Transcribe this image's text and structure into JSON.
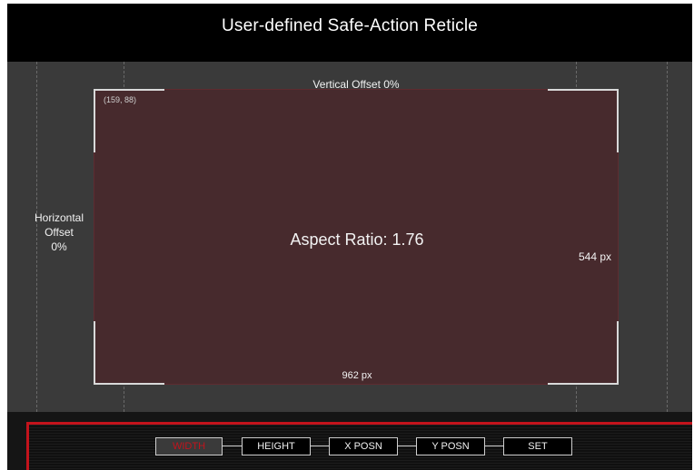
{
  "header": {
    "title": "User-defined Safe-Action Reticle"
  },
  "reticle": {
    "vertical_offset": "Vertical Offset 0%",
    "horizontal_offset": [
      "Horizontal",
      "Offset",
      "0%"
    ],
    "corner_coordinates": "(159, 88)",
    "aspect_ratio": "Aspect Ratio: 1.76",
    "width": "962 px",
    "height": "544 px"
  },
  "menu": {
    "buttons": [
      {
        "label": "WIDTH",
        "active": true
      },
      {
        "label": "HEIGHT",
        "active": false
      },
      {
        "label": "X POSN",
        "active": false
      },
      {
        "label": "Y POSN",
        "active": false
      },
      {
        "label": "SET",
        "active": false
      }
    ]
  },
  "colors": {
    "background": "#000000",
    "canvas": "#3a3a3a",
    "reticle_fill": "#472a2d",
    "accent_red": "#c3131c",
    "text": "#f2f2f2"
  }
}
